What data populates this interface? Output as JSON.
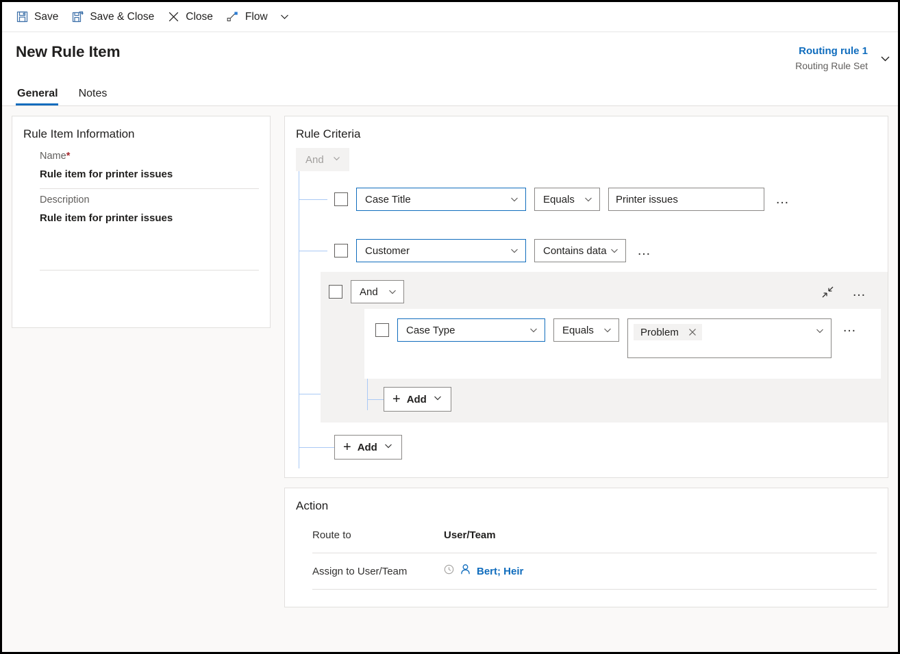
{
  "commandbar": {
    "items": [
      {
        "label": "Save",
        "icon": "save-icon"
      },
      {
        "label": "Save & Close",
        "icon": "save-and-close-icon"
      },
      {
        "label": "Close",
        "icon": "close-x-icon"
      },
      {
        "label": "Flow",
        "icon": "flow-icon"
      }
    ],
    "overflow_icon": "chevron-down-icon"
  },
  "header": {
    "title": "New Rule Item",
    "record_name": "Routing rule 1",
    "record_type": "Routing Rule Set",
    "expand_icon": "chevron-down-icon",
    "tabs": [
      {
        "label": "General",
        "active": true
      },
      {
        "label": "Notes",
        "active": false
      }
    ]
  },
  "rule_item_information": {
    "title": "Rule Item Information",
    "name_label": "Name",
    "name_required_marker": "*",
    "name_value": "Rule item for printer issues",
    "description_label": "Description",
    "description_value": "Rule item for printer issues"
  },
  "rule_criteria": {
    "title": "Rule Criteria",
    "root_operator": "And",
    "root_operator_icon": "chevron-down-icon",
    "rows": [
      {
        "attribute": "Case Title",
        "operator": "Equals",
        "value": "Printer issues",
        "value_type": "text",
        "overflow": "…"
      },
      {
        "attribute": "Customer",
        "operator": "Contains data",
        "value": "",
        "value_type": "none",
        "overflow": "…"
      }
    ],
    "group": {
      "operator": "And",
      "operator_icon": "chevron-down-icon",
      "collapse_icon": "ungroup-icon",
      "overflow": "…",
      "rows": [
        {
          "attribute": "Case Type",
          "operator": "Equals",
          "value_tags": [
            "Problem"
          ],
          "tag_remove_icon": "close-x-icon",
          "value_chevron_icon": "chevron-down-icon",
          "overflow": "…"
        }
      ],
      "add_label": "Add",
      "add_icon": "plus-icon",
      "add_chevron_icon": "chevron-down-icon"
    },
    "add_label": "Add",
    "add_icon": "plus-icon",
    "add_chevron_icon": "chevron-down-icon"
  },
  "action": {
    "title": "Action",
    "route_to_label": "Route to",
    "route_to_value": "User/Team",
    "assign_label": "Assign to User/Team",
    "assign_value": "Bert; Heir",
    "assign_status_icon": "clock-icon",
    "assign_person_icon": "person-icon"
  },
  "colors": {
    "accent": "#0f6cbd",
    "required": "#a4262c",
    "tree_line": "#a9c9f5",
    "group_bg": "#f3f2f1",
    "page_bg": "#faf9f8"
  }
}
